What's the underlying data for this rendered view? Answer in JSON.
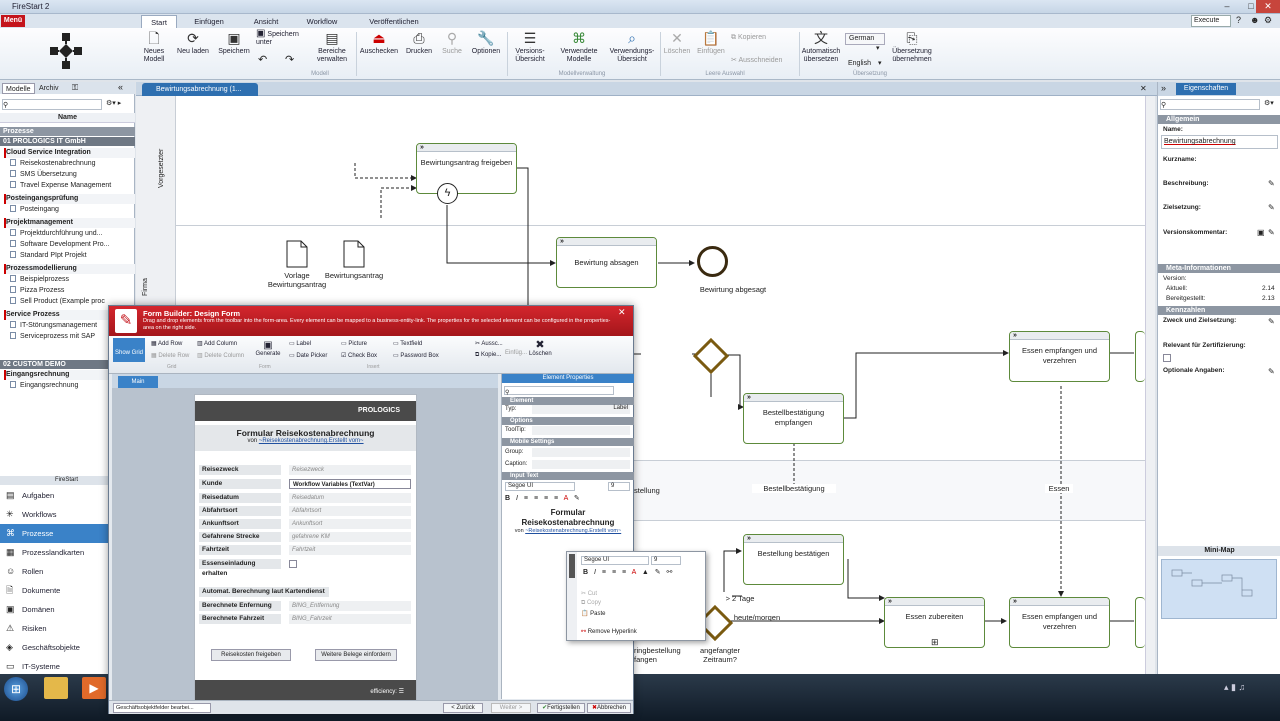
{
  "app": {
    "title": "FireStart 2",
    "user": "Execute"
  },
  "menu": {
    "label": "Menü"
  },
  "ribbon_tabs": [
    "Start",
    "Einfügen",
    "Ansicht",
    "Workflow",
    "Veröffentlichen"
  ],
  "ribbon": {
    "modell": [
      "Neues Modell",
      "Neu laden",
      "Speichern",
      "Speichern unter",
      "Bereiche verwalten"
    ],
    "group_modell": "Modell",
    "actions": [
      "Auschecken",
      "Drucken",
      "Suche",
      "Optionen"
    ],
    "versions": [
      "Versions- Übersicht",
      "Verwendete Modelle",
      "Verwendungs- Übersicht"
    ],
    "group_versions": "Modellverwaltung",
    "auswahl": [
      "Löschen",
      "Einfügen",
      "Kopieren",
      "Ausschneiden"
    ],
    "group_auswahl": "Leere Auswahl",
    "translate": "Automatisch übersetzen",
    "lang_from": "German",
    "lang_to": "English",
    "take_over": "Übersetzung übernehmen",
    "group_translate": "Übersetzung"
  },
  "left": {
    "tabs": [
      "Modelle",
      "Archiv"
    ],
    "col": "Name",
    "sec_processes": "Prozesse",
    "company": "01 PROLOGICS IT GmbH",
    "groups": [
      {
        "name": "Cloud Service Integration",
        "items": [
          "Reisekostenabrechnung",
          "SMS Übersetzung",
          "Travel Expense Management"
        ]
      },
      {
        "name": "Posteingangsprüfung",
        "items": [
          "Posteingang"
        ]
      },
      {
        "name": "Projektmanagement",
        "items": [
          "Projektdurchführung und...",
          "Software Development Pro...",
          "Standard PIpt Projekt"
        ]
      },
      {
        "name": "Prozessmodellierung",
        "items": [
          "Beispielprozess",
          "Pizza Prozess",
          "Sell Product (Example proc"
        ]
      },
      {
        "name": "Service Prozess",
        "items": [
          "IT-Störungsmanagement",
          "Serviceprozess mit SAP"
        ]
      }
    ],
    "custom": "02 CUSTOM DEMO",
    "eingang": "Eingangsrechnung",
    "eingang_item": "Eingangsrechnung",
    "firestart": "FireStart",
    "nav": [
      "Aufgaben",
      "Workflows",
      "Prozesse",
      "Prozesslandkarten",
      "Rollen",
      "Dokumente",
      "Domänen",
      "Risiken",
      "Geschäftsobjekte",
      "IT-Systeme"
    ]
  },
  "doc_tab": "Bewirtungsabrechnung (1...",
  "lanes": {
    "vorgesetzter": "Vorgesetzter",
    "firma": "Firma"
  },
  "diagram": {
    "t1": "Bewirtungsantrag freigeben",
    "t2": "Bewirtung absagen",
    "end1": "Bewirtung abgesagt",
    "doc1": "Vorlage Bewirtungsantrag",
    "doc2": "Bewirtungsantrag",
    "t3": "Essen empfangen und verzehren",
    "t4": "Bestellbestätigung empfangen",
    "m1": "Bestellbestätigung",
    "m2": "Essen",
    "t5": "Bestellung bestätigen",
    "t6": "Essen zubereiten",
    "t7": "Essen empfangen und verzehren",
    "c1": "> 2 Tage",
    "c2": "heute/morgen",
    "c3": "angefangter Zeitraum?",
    "c4": "ringbestellung fangen",
    "c5": "stellung"
  },
  "props": {
    "tab": "Eigenschaften",
    "allgemein": "Allgemein",
    "name_l": "Name:",
    "name_v": "Bewirtungsabrechnung",
    "kurzname": "Kurzname:",
    "beschreibung": "Beschreibung:",
    "zielsetzung": "Zielsetzung:",
    "versionskommentar": "Versionskommentar:",
    "meta": "Meta-Informationen",
    "version": "Version:",
    "aktuell": "Aktuell:",
    "aktuell_v": "2.14",
    "bereit": "Bereitgestellt:",
    "bereit_v": "2.13",
    "kennzahlen": "Kennzahlen",
    "k1": "Zweck und Zielsetzung:",
    "k2": "Relevant für Zertifizierung:",
    "k3": "Optionale Angaben:",
    "minimap": "Mini-Map"
  },
  "dialog": {
    "title": "Form Builder: Design Form",
    "desc": "Drag and drop elements from the toolbar into the form-area. Every element can be mapped to a business-entity-link. The properties for the selected element can be configured in the properties-area on the right side.",
    "tb_grid": "Show Grid",
    "tb": [
      "Add Row",
      "Delete Row",
      "Add Column",
      "Delete Column",
      "Generate",
      "Label",
      "Date Picker",
      "Picture",
      "Check Box",
      "Textfield",
      "Password Box",
      "Aussc...",
      "Kopie...",
      "Einfüg...",
      "Löschen"
    ],
    "grp": [
      "Grid",
      "Form",
      "Insert"
    ],
    "tab_main": "Main",
    "logo": "PROLOGICS",
    "form_title": "Formular Reisekostenabrechnung",
    "form_von": "von",
    "form_link": "~Reisekostenabrechnung.Erstellt vom~",
    "rows": [
      {
        "l": "Reisezweck",
        "v": "Reisezweck"
      },
      {
        "l": "Kunde",
        "v": "Workflow Variables (TextVar)"
      },
      {
        "l": "Reisedatum",
        "v": "Reisedatum"
      },
      {
        "l": "Abfahrtsort",
        "v": "Abfahrtsort"
      },
      {
        "l": "Ankunftsort",
        "v": "Ankunftsort"
      },
      {
        "l": "Gefahrene Strecke",
        "v": "gefahrene KM"
      },
      {
        "l": "Fahrtzeit",
        "v": "Fahrtzeit"
      },
      {
        "l": "Essenseinladung erhalten",
        "v": ""
      }
    ],
    "auto": "Automat. Berechnung laut Kartendienst",
    "rows2": [
      {
        "l": "Berechnete Enfernung",
        "v": "BING_Entfernung"
      },
      {
        "l": "Berechnete Fahrzeit",
        "v": "BING_Fahrzeit"
      }
    ],
    "btn1": "Reisekosten freigeben",
    "btn2": "Weitere Belege einfordern",
    "efficiency": "efficiency:",
    "props_title": "Element Properties",
    "p_element": "Element",
    "p_typ": "Typ:",
    "p_typ_v": "Label",
    "p_options": "Options",
    "p_tooltip": "ToolTip:",
    "p_mobile": "Mobile Settings",
    "p_group": "Group:",
    "p_caption": "Caption:",
    "p_input": "Input Text",
    "p_font": "Segoe UI",
    "p_size": "9",
    "p_preview_title": "Formular Reisekostenabrechnung",
    "p_preview_von": "von",
    "p_preview_link": "~Reisekostenabrechnung.Erstellt vom~",
    "back": "< Zurück",
    "next": "Weiter >",
    "done": "Fertigstellen",
    "cancel": "Abbrechen",
    "bottom": "Geschäftsobjektfelder bearbei..."
  },
  "ctx": {
    "font": "Segoe UI",
    "size": "9",
    "items": [
      "Cut",
      "Copy",
      "Paste",
      "Remove Hyperlink"
    ]
  }
}
